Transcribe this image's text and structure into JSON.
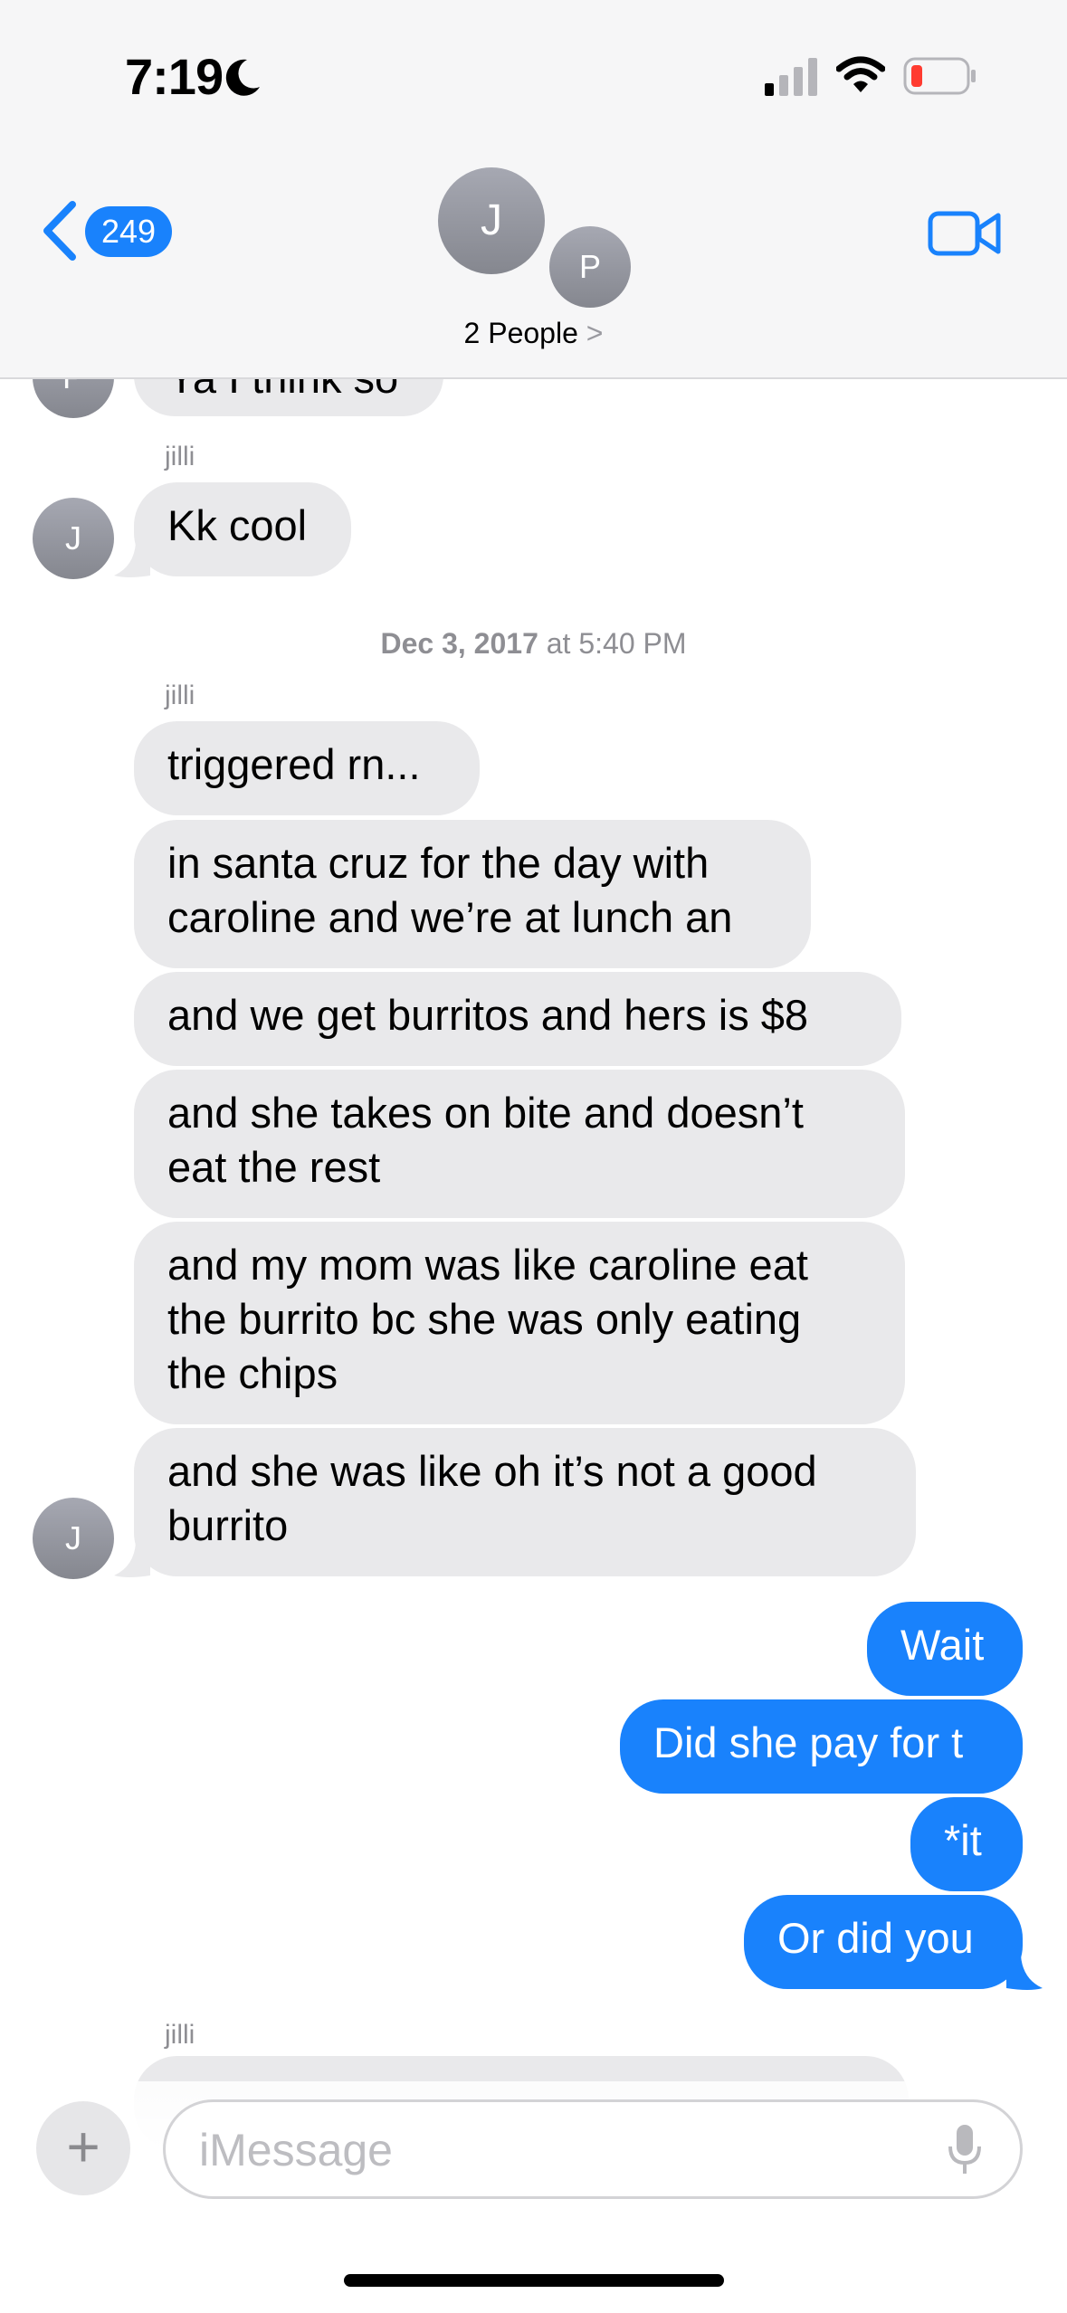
{
  "status": {
    "time": "7:19"
  },
  "header": {
    "back_count": "249",
    "avatar_main": "J",
    "avatar_secondary": "P",
    "title": "2 People",
    "title_chevron": ">"
  },
  "partial_top": {
    "avatar": "P",
    "text": "Ya I think so"
  },
  "thread": {
    "sender_1": "jilli",
    "msg_kk": "Kk cool",
    "avatar_j": "J",
    "timestamp_date": "Dec 3, 2017",
    "timestamp_rest": " at 5:40 PM",
    "sender_2": "jilli",
    "in_msgs": [
      {
        "lines": [
          "triggered rn..."
        ]
      },
      {
        "lines": [
          "in santa cruz for the day with",
          "caroline and we’re at lunch an"
        ]
      },
      {
        "lines": [
          "and we get burritos and hers is $8"
        ]
      },
      {
        "lines": [
          "and she takes on bite and doesn’t",
          "eat the rest"
        ]
      },
      {
        "lines": [
          "and my mom was like caroline eat",
          "the burrito bc she was only eating",
          "the chips"
        ]
      },
      {
        "lines": [
          "and she was like oh it’s not a good",
          "burrito"
        ]
      }
    ],
    "out_msgs": [
      "Wait",
      "Did she pay for t",
      "*it",
      "Or did you"
    ],
    "sender_3": "jilli"
  },
  "composer": {
    "plus": "+",
    "placeholder": "iMessage"
  },
  "colors": {
    "blue": "#1982fc",
    "incoming": "#e9e9eb",
    "header_bg": "#f6f6f7"
  },
  "icons": [
    "moon-icon",
    "cellular-signal-icon",
    "wifi-icon",
    "battery-low-icon",
    "back-chevron-icon",
    "video-camera-icon",
    "microphone-icon",
    "plus-icon"
  ]
}
